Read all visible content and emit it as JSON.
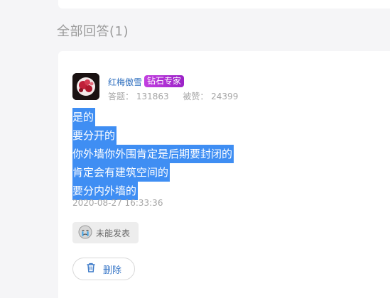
{
  "section": {
    "title": "全部回答(1)"
  },
  "answer": {
    "user": {
      "name": "红梅傲雪",
      "badge": "钻石专家",
      "answers_label": "答题：",
      "answers_count": "131863",
      "likes_label": "被赞：",
      "likes_count": "24399"
    },
    "lines": [
      "是的",
      "要分开的",
      "你外墙你外围肯定是后期要封闭的",
      "肯定会有建筑空间的",
      "要分内外墙的"
    ],
    "timestamp": "2020-08-27 16:33:36",
    "reaction_label": "未能发表",
    "delete_label": "删除"
  },
  "colors": {
    "selection": "#3f8ef3",
    "badge": "#a62bd3",
    "link": "#2f6fbf",
    "muted": "#a5a5a5"
  },
  "icons": {
    "reaction": "crying-face-icon",
    "delete": "trash-icon"
  }
}
